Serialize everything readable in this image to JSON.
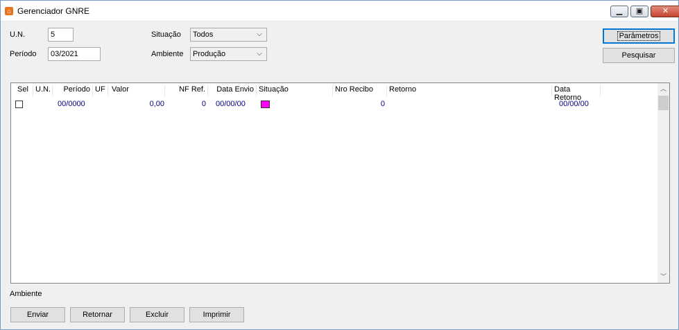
{
  "window": {
    "title": "Gerenciador GNRE"
  },
  "filters": {
    "un_label": "U.N.",
    "un_value": "5",
    "periodo_label": "Período",
    "periodo_value": "03/2021",
    "situacao_label": "Situação",
    "situacao_value": "Todos",
    "ambiente_label": "Ambiente",
    "ambiente_value": "Produção"
  },
  "buttons": {
    "parametros": "Parâmetros",
    "pesquisar": "Pesquisar",
    "enviar": "Enviar",
    "retornar": "Retornar",
    "excluir": "Excluir",
    "imprimir": "Imprimir"
  },
  "grid": {
    "headers": {
      "sel": "Sel",
      "un": "U.N.",
      "periodo": "Período",
      "uf": "UF",
      "valor": "Valor",
      "nf_ref": "NF Ref.",
      "data_envio": "Data Envio",
      "situacao": "Situação",
      "nro_recibo": "Nro Recibo",
      "retorno": "Retorno",
      "data_retorno": "Data Retorno"
    },
    "rows": [
      {
        "periodo": "00/0000",
        "valor": "0,00",
        "nf_ref": "0",
        "data_envio": "00/00/00",
        "nro_recibo": "0",
        "data_retorno": "00/00/00",
        "situacao_color": "#ff00ff"
      }
    ]
  },
  "footer": {
    "ambiente_label": "Ambiente"
  }
}
